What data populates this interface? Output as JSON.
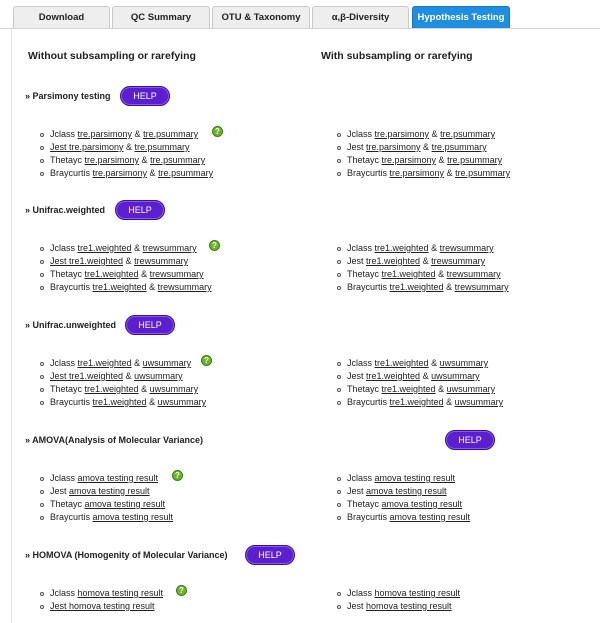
{
  "tabs": [
    "Download",
    "QC Summary",
    "OTU & Taxonomy",
    "α,β-Diversity",
    "Hypothesis Testing"
  ],
  "columns": {
    "left_heading": "Without subsampling or rarefying",
    "right_heading": "With subsampling or rarefying"
  },
  "help_label": "HELP",
  "sections": [
    {
      "title": "» Parsimony testing",
      "left": [
        {
          "label": "Jclass",
          "l1": "tre.parsimony",
          "sep": "&",
          "l2": "tre.psummary"
        },
        {
          "label": "",
          "l1": "Jest tre.parsimony",
          "sep": "&",
          "l2": "tre.psummary"
        },
        {
          "label": "Thetayc",
          "l1": "tre.parsimony",
          "sep": "&",
          "l2": "tre.psummary"
        },
        {
          "label": "Braycurtis",
          "l1": "tre.parsimony",
          "sep": "&",
          "l2": "tre.psummary"
        }
      ],
      "right": [
        {
          "label": "Jclass",
          "l1": "tre.parsimony",
          "sep": "&",
          "l2": "tre.psummary"
        },
        {
          "label": "Jest",
          "l1": "tre.parsimony",
          "sep": "&",
          "l2": "tre.psummary"
        },
        {
          "label": "Thetayc",
          "l1": "tre.parsimony",
          "sep": "&",
          "l2": "tre.psummary"
        },
        {
          "label": "Braycurtis",
          "l1": "tre.parsimony",
          "sep": "&",
          "l2": "tre.psummary"
        }
      ]
    },
    {
      "title": "» Unifrac.weighted",
      "left": [
        {
          "label": "Jclass",
          "l1": "tre1.weighted",
          "sep": "&",
          "l2": "trewsummary"
        },
        {
          "label": "",
          "l1": "Jest tre1.weighted",
          "sep": "&",
          "l2": "trewsummary"
        },
        {
          "label": "Thetayc",
          "l1": "tre1.weighted",
          "sep": "&",
          "l2": "trewsummary"
        },
        {
          "label": "Braycurtis",
          "l1": "tre1.weighted",
          "sep": "&",
          "l2": "trewsummary"
        }
      ],
      "right": [
        {
          "label": "Jclass",
          "l1": "tre1.weighted",
          "sep": "&",
          "l2": "trewsummary"
        },
        {
          "label": "Jest",
          "l1": "tre1.weighted",
          "sep": "&",
          "l2": "trewsummary"
        },
        {
          "label": "Thetayc",
          "l1": "tre1.weighted",
          "sep": "&",
          "l2": "trewsummary"
        },
        {
          "label": "Braycurtis",
          "l1": "tre1.weighted",
          "sep": "&",
          "l2": "trewsummary"
        }
      ]
    },
    {
      "title": "» Unifrac.unweighted",
      "left": [
        {
          "label": "Jclass",
          "l1": "tre1.weighted",
          "sep": "&",
          "l2": "uwsummary"
        },
        {
          "label": "",
          "l1": "Jest tre1.weighted",
          "sep": "&",
          "l2": "uwsummary"
        },
        {
          "label": "Thetayc",
          "l1": "tre1.weighted",
          "sep": "&",
          "l2": "uwsummary"
        },
        {
          "label": "Braycurtis",
          "l1": "tre1.weighted",
          "sep": "&",
          "l2": "uwsummary"
        }
      ],
      "right": [
        {
          "label": "Jclass",
          "l1": "tre1.weighted",
          "sep": "&",
          "l2": "uwsummary"
        },
        {
          "label": "Jest",
          "l1": "tre1.weighted",
          "sep": "&",
          "l2": "uwsummary"
        },
        {
          "label": "Thetayc",
          "l1": "tre1.weighted",
          "sep": "&",
          "l2": "uwsummary"
        },
        {
          "label": "Braycurtis",
          "l1": "tre1.weighted",
          "sep": "&",
          "l2": "uwsummary"
        }
      ]
    },
    {
      "title": "» AMOVA(Analysis of Molecular Variance)",
      "left": [
        {
          "label": "Jclass",
          "l1": "amova testing result",
          "sep": "",
          "l2": ""
        },
        {
          "label": "Jest",
          "l1": "amova testing result",
          "sep": "",
          "l2": ""
        },
        {
          "label": "Thetayc",
          "l1": "amova testing result",
          "sep": "",
          "l2": ""
        },
        {
          "label": "Braycurtis",
          "l1": "amova testing result",
          "sep": "",
          "l2": ""
        }
      ],
      "right": [
        {
          "label": "Jclass",
          "l1": "amova testing result",
          "sep": "",
          "l2": ""
        },
        {
          "label": "Jest",
          "l1": "amova testing result",
          "sep": "",
          "l2": ""
        },
        {
          "label": "Thetayc",
          "l1": "amova testing result",
          "sep": "",
          "l2": ""
        },
        {
          "label": "Braycurtis",
          "l1": "amova testing result",
          "sep": "",
          "l2": ""
        }
      ]
    },
    {
      "title": "» HOMOVA (Homogenity of Molecular Variance)",
      "left": [
        {
          "label": "Jclass",
          "l1": "homova testing result",
          "sep": "",
          "l2": ""
        },
        {
          "label": "",
          "l1": "Jest homova testing result",
          "sep": "",
          "l2": ""
        }
      ],
      "right": [
        {
          "label": "Jclass",
          "l1": "homova testing result",
          "sep": "",
          "l2": ""
        },
        {
          "label": "Jest",
          "l1": "homova testing result",
          "sep": "",
          "l2": ""
        }
      ]
    }
  ],
  "icons": {
    "info": "info-icon",
    "info_color": "#6ab825",
    "help_color": "#5b1fd0",
    "active_tab_color": "#1e8ee0"
  }
}
